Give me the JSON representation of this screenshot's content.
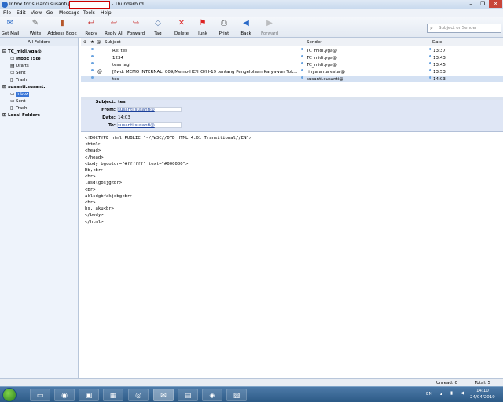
{
  "window": {
    "title": "Inbox for susanti.susanti@",
    "title_suffix": "- Thunderbird",
    "minimize": "–",
    "maximize": "❐",
    "close": "✕"
  },
  "menu": [
    "File",
    "Edit",
    "View",
    "Go",
    "Message",
    "Tools",
    "Help"
  ],
  "toolbar": {
    "get_mail": "Get Mail",
    "write": "Write",
    "address_book": "Address Book",
    "reply": "Reply",
    "reply_all": "Reply All",
    "forward": "Forward",
    "tag": "Tag",
    "delete": "Delete",
    "junk": "Junk",
    "print": "Print",
    "back": "Back",
    "forward_nav": "Forward",
    "search_placeholder": "Subject or Sender"
  },
  "folders": {
    "header": "All Folders",
    "accounts": [
      {
        "name": "TC_midi.yga@",
        "items": [
          "Inbox (58)",
          "Drafts",
          "Sent",
          "Trash"
        ]
      },
      {
        "name": "susanti.susant..",
        "items": [
          "Inbox",
          "Sent",
          "Trash"
        ]
      }
    ],
    "local": "Local Folders"
  },
  "thread_columns": {
    "subject": "Subject",
    "sender": "Sender",
    "date": "Date"
  },
  "messages": [
    {
      "subject": "Re: tes",
      "sender": "TC_midi.yga@",
      "date": "13:37"
    },
    {
      "subject": "1234",
      "sender": "TC_midi.yga@",
      "date": "13:43"
    },
    {
      "subject": "tess lagi",
      "sender": "TC_midi.yga@",
      "date": "13:45"
    },
    {
      "subject": "[Fwd: MEMO INTERNAL: 009/Memo-HC/HO/III-19 tentang Pengelolaan Karyawan Tok...",
      "sender": "rinya.antarestal@",
      "date": "13:53"
    },
    {
      "subject": "tes",
      "sender": "susanti.susanti@",
      "date": "14:03"
    }
  ],
  "header": {
    "subject_label": "Subject:",
    "subject": "tes",
    "from_label": "From:",
    "from": "susanti.susanti@",
    "date_label": "Date:",
    "date": "14:03",
    "to_label": "To:",
    "to": "susanti.susanti@"
  },
  "body_lines": [
    "<!DOCTYPE html PUBLIC \"-//W3C//DTD HTML 4.01 Transitional//EN\">",
    "<html>",
    "<head>",
    "</head>",
    "<body bgcolor=\"#ffffff\" text=\"#000000\">",
    "Db,<br>",
    "<br>",
    "lasdlgbsjg<br>",
    "<br>",
    "aklsdgbfakjdbg<br>",
    "<br>",
    "hs, aku<br>",
    "</body>",
    "</html>"
  ],
  "status": {
    "unread": "Unread: 0",
    "total": "Total: 5"
  },
  "tray": {
    "lang": "EN",
    "time": "14:10",
    "date": "24/04/2019"
  },
  "colors": {
    "accent": "#3875d7",
    "header_bg": "#dfe6f5",
    "taskbar": "#2c5a86"
  }
}
